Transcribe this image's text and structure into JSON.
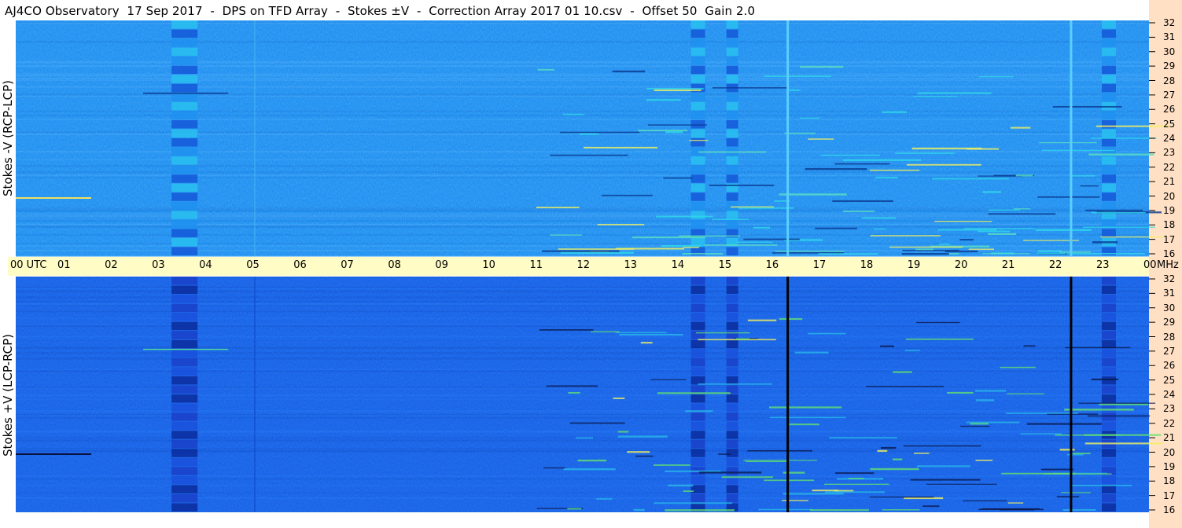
{
  "header": {
    "title": "AJ4CO Observatory  17 Sep 2017  -  DPS on TFD Array  -  Stokes ±V  -  Correction Array 2017 01 10.csv  -  Offset 50  Gain 2.0"
  },
  "chart_data": {
    "type": "heatmap",
    "x_tick_labels": [
      "00  UTC",
      "01",
      "02",
      "03",
      "04",
      "05",
      "06",
      "07",
      "08",
      "09",
      "10",
      "11",
      "12",
      "13",
      "14",
      "15",
      "16",
      "17",
      "18",
      "19",
      "20",
      "21",
      "22",
      "23",
      "00"
    ],
    "x_range_hours_utc": [
      0,
      24
    ],
    "y_unit": "MHz",
    "y_range_mhz": [
      16,
      32
    ],
    "y_tick_values": [
      32,
      31,
      30,
      29,
      28,
      27,
      26,
      25,
      24,
      23,
      22,
      21,
      20,
      19,
      18,
      17,
      16
    ],
    "panels": [
      {
        "ylabel": "Stokes -V  (RCP-LCP)",
        "base_color": "#1a8cf0",
        "vertical_lines": [
          {
            "hour_utc": 16.35,
            "color": "#5ad0ff"
          },
          {
            "hour_utc": 22.35,
            "color": "#5ad0ff"
          }
        ]
      },
      {
        "ylabel": "Stokes +V  (LCP-RCP)",
        "base_color": "#1560e6",
        "vertical_lines": [
          {
            "hour_utc": 16.35,
            "color": "#000000"
          },
          {
            "hour_utc": 22.35,
            "color": "#000000"
          }
        ]
      }
    ],
    "noise_bands": [
      {
        "hour_start": 3.3,
        "hour_end": 3.85,
        "label": ""
      },
      {
        "hour_start": 14.3,
        "hour_end": 14.6,
        "label": ""
      },
      {
        "hour_start": 15.05,
        "hour_end": 15.3,
        "label": ""
      },
      {
        "hour_start": 23.0,
        "hour_end": 23.3,
        "label": ""
      }
    ]
  }
}
